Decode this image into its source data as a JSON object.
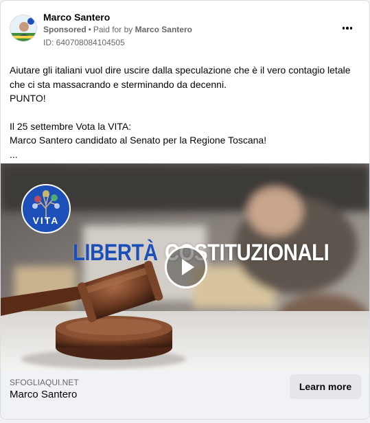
{
  "post": {
    "page_name": "Marco Santero",
    "sponsored_label": "Sponsored",
    "paid_for_prefix": "Paid for by",
    "paid_for_name": "Marco Santero",
    "ad_id": "ID: 640708084104505",
    "menu_icon": "more-horizontal-icon",
    "text_lines": [
      "Aiutare gli italiani vuol dire uscire dalla speculazione che è il vero contagio letale che ci sta massacrando e sterminando da decenni.",
      "PUNTO!",
      "Il 25 settembre Vota la VITA:",
      "Marco Santero candidato al Senato per la Regione Toscana!",
      "..."
    ]
  },
  "media": {
    "logo_text": "VITA",
    "headline_word1": "LIBERTÀ",
    "headline_word2": "COSTITUZIONALI",
    "play_icon": "play-icon",
    "headline_color": "#1d4fb8"
  },
  "footer": {
    "domain": "SFOGLIAQUI.NET",
    "title": "Marco Santero",
    "cta_label": "Learn more"
  }
}
